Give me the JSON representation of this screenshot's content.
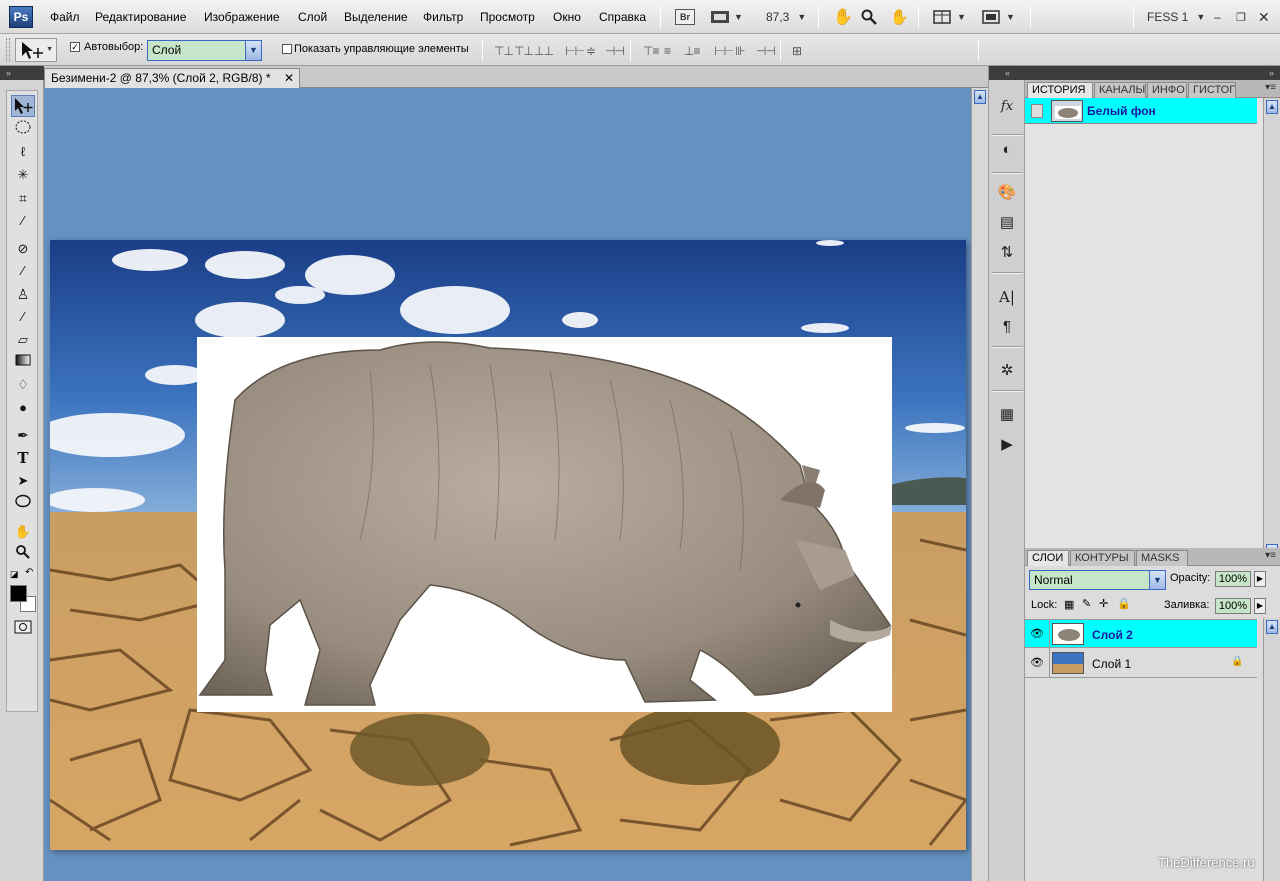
{
  "app": {
    "logo": "Ps",
    "workspace": "FESS 1",
    "zoom": "87,3",
    "bridge_label": "Br"
  },
  "menu": [
    "Файл",
    "Редактирование",
    "Изображение",
    "Слой",
    "Выделение",
    "Фильтр",
    "Просмотр",
    "Окно",
    "Справка"
  ],
  "options": {
    "autoselect_label": "Автовыбор:",
    "autoselect_checked": true,
    "autoselect_value": "Слой",
    "show_controls_label": "Показать управляющие элементы",
    "show_controls_checked": false
  },
  "document": {
    "tab_title": "Безимени-2 @ 87,3% (Слой 2, RGB/8) *"
  },
  "panels": {
    "top_tabs": [
      "ИСТОРИЯ",
      "КАНАЛЫ",
      "ИНФО",
      "ГИСТОГР"
    ],
    "history_items": [
      {
        "label": "Белый фон",
        "selected": true
      }
    ],
    "layer_tabs": [
      "СЛОИ",
      "КОНТУРЫ",
      "MASKS"
    ],
    "blend_mode": "Normal",
    "opacity_label": "Opacity:",
    "opacity_value": "100%",
    "lock_label": "Lock:",
    "fill_label": "Заливка:",
    "fill_value": "100%",
    "layers": [
      {
        "name": "Слой 2",
        "selected": true,
        "visible": true,
        "locked": false
      },
      {
        "name": "Слой 1",
        "selected": false,
        "visible": true,
        "locked": true
      }
    ]
  },
  "watermark": "TheDifference.ru",
  "colors": {
    "canvas_bg": "#6591c0",
    "selection_cyan": "#00ffff",
    "combo_green": "#c7e5c8"
  }
}
